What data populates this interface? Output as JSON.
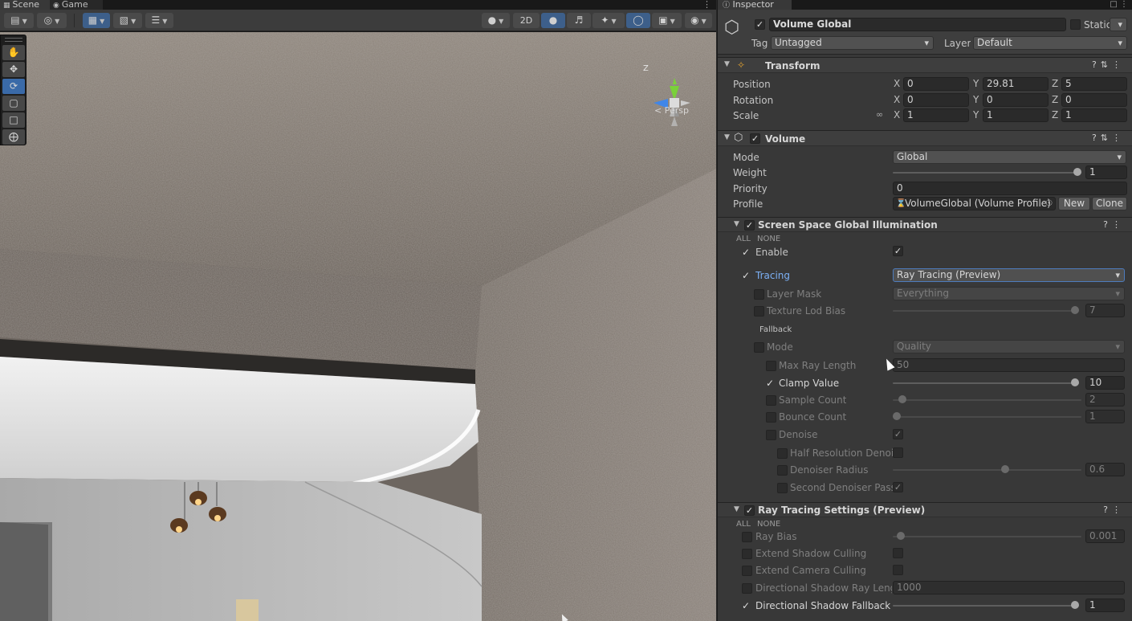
{
  "scene_tabs": [
    {
      "label": "Scene",
      "icon": "grid-icon"
    },
    {
      "label": "Game",
      "icon": "gamepad-icon"
    }
  ],
  "scene_toolbar": {
    "btn_2d": "2D"
  },
  "gizmo": {
    "persp_label": "< Persp",
    "axis_z": "Z"
  },
  "inspector": {
    "tab_label": "Inspector",
    "object": {
      "name": "Volume Global",
      "active": true,
      "static_label": "Static",
      "tag_label": "Tag",
      "tag_value": "Untagged",
      "layer_label": "Layer",
      "layer_value": "Default"
    },
    "transform": {
      "title": "Transform",
      "position_label": "Position",
      "rotation_label": "Rotation",
      "scale_label": "Scale",
      "axis_x": "X",
      "axis_y": "Y",
      "axis_z": "Z",
      "position": {
        "x": "0",
        "y": "29.81",
        "z": "5"
      },
      "rotation": {
        "x": "0",
        "y": "0",
        "z": "0"
      },
      "scale": {
        "x": "1",
        "y": "1",
        "z": "1"
      }
    },
    "volume": {
      "title": "Volume",
      "mode_label": "Mode",
      "mode_value": "Global",
      "weight_label": "Weight",
      "weight_value": "1",
      "weight_fraction": 1.0,
      "priority_label": "Priority",
      "priority_value": "0",
      "profile_label": "Profile",
      "profile_value": "VolumeGlobal (Volume Profile)",
      "new_btn": "New",
      "clone_btn": "Clone"
    },
    "ssgi": {
      "title": "Screen Space Global Illumination",
      "all_label": "ALL",
      "none_label": "NONE",
      "enable_label": "Enable",
      "tracing_label": "Tracing",
      "tracing_value": "Ray Tracing (Preview)",
      "layer_mask_label": "Layer Mask",
      "layer_mask_value": "Everything",
      "texture_lod_label": "Texture Lod Bias",
      "texture_lod_value": "7",
      "texture_lod_fraction": 1.0,
      "fallback_label": "Fallback",
      "mode_label": "Mode",
      "mode_value": "Quality",
      "max_ray_label": "Max Ray Length",
      "max_ray_value": "50",
      "clamp_label": "Clamp Value",
      "clamp_value": "10",
      "clamp_fraction": 1.0,
      "sample_count_label": "Sample Count",
      "sample_count_value": "2",
      "sample_count_fraction": 0.03,
      "bounce_count_label": "Bounce Count",
      "bounce_count_value": "1",
      "bounce_count_fraction": 0.0,
      "denoise_label": "Denoise",
      "half_res_label": "Half Resolution Denoiser",
      "denoiser_radius_label": "Denoiser Radius",
      "denoiser_radius_value": "0.6",
      "denoiser_radius_fraction": 0.6,
      "second_denoiser_label": "Second Denoiser Pass"
    },
    "rts": {
      "title": "Ray Tracing Settings (Preview)",
      "all_label": "ALL",
      "none_label": "NONE",
      "ray_bias_label": "Ray Bias",
      "ray_bias_value": "0.001",
      "ray_bias_fraction": 0.02,
      "extend_shadow_label": "Extend Shadow Culling",
      "extend_camera_label": "Extend Camera Culling",
      "dir_shadow_len_label": "Directional Shadow Ray Length",
      "dir_shadow_len_value": "1000",
      "dir_shadow_fallback_label": "Directional Shadow Fallback Intensity",
      "dir_shadow_fallback_value": "1",
      "dir_shadow_fallback_fraction": 1.0
    }
  },
  "colors": {
    "accent": "#3d5f8a",
    "tracing_label": "#7cb0f5",
    "panel_bg": "#383838"
  }
}
